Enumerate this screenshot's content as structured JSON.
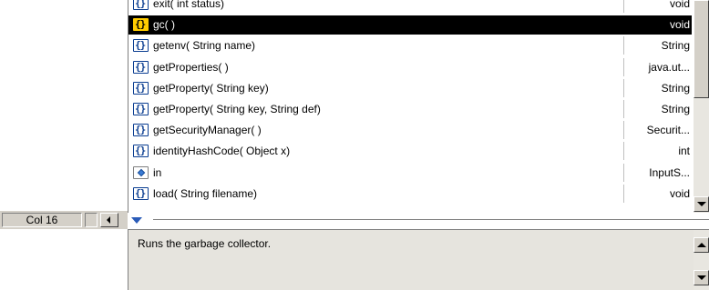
{
  "status_bar": {
    "col_indicator": "Col 16"
  },
  "completion_list": {
    "selected_index": 1,
    "items": [
      {
        "kind": "method",
        "icon": "method-icon",
        "name": "exit( int status)",
        "type": "void"
      },
      {
        "kind": "method",
        "icon": "method-icon",
        "name": "gc( )",
        "type": "void"
      },
      {
        "kind": "method",
        "icon": "method-icon",
        "name": "getenv( String name)",
        "type": "String"
      },
      {
        "kind": "method",
        "icon": "method-icon",
        "name": "getProperties( )",
        "type": "java.ut..."
      },
      {
        "kind": "method",
        "icon": "method-icon",
        "name": "getProperty( String key)",
        "type": "String"
      },
      {
        "kind": "method",
        "icon": "method-icon",
        "name": "getProperty( String key, String def)",
        "type": "String"
      },
      {
        "kind": "method",
        "icon": "method-icon",
        "name": "getSecurityManager( )",
        "type": "Securit..."
      },
      {
        "kind": "method",
        "icon": "method-icon",
        "name": "identityHashCode( Object x)",
        "type": "int"
      },
      {
        "kind": "field",
        "icon": "field-icon",
        "name": "in",
        "type": "InputS..."
      },
      {
        "kind": "method",
        "icon": "method-icon",
        "name": "load( String filename)",
        "type": "void"
      }
    ]
  },
  "description": {
    "text": "Runs the garbage collector."
  }
}
